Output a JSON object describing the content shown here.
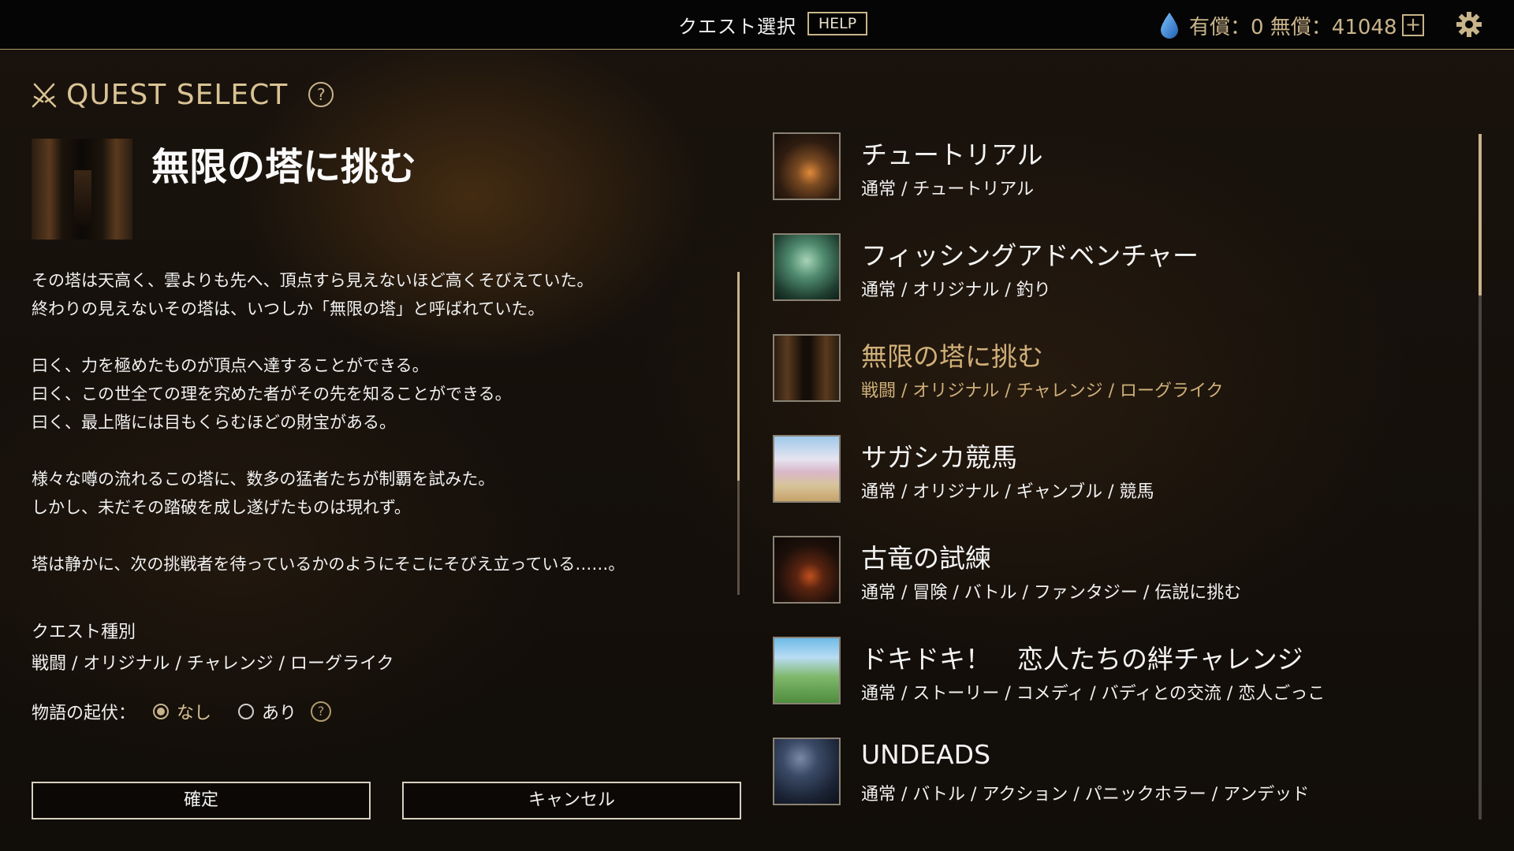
{
  "topbar": {
    "title": "クエスト選択",
    "help_label": "HELP",
    "currency_text": "有償：0 無償：41048",
    "plus_label": "+",
    "icons": [
      "drop-icon",
      "gear-icon"
    ]
  },
  "header": {
    "title": "QUEST SELECT",
    "help_label": "?"
  },
  "detail": {
    "title": "無限の塔に挑む",
    "description": [
      "その塔は天高く、雲よりも先へ、頂点すら見えないほど高くそびえていた。",
      "終わりの見えないその塔は、いつしか「無限の塔」と呼ばれていた。",
      "",
      "曰く、力を極めたものが頂点へ達することができる。",
      "曰く、この世全ての理を究めた者がその先を知ることができる。",
      "曰く、最上階には目もくらむほどの財宝がある。",
      "",
      "様々な噂の流れるこの塔に、数多の猛者たちが制覇を試みた。",
      "しかし、未だその踏破を成し遂げたものは現れず。",
      "",
      "塔は静かに、次の挑戦者を待っているかのようにそこにそびえ立っている……。"
    ],
    "type_label": "クエスト種別",
    "type_value": "戦闘 / オリジナル / チャレンジ / ローグライク",
    "rise_label": "物語の起伏：",
    "rise_options": [
      "なし",
      "あり"
    ],
    "rise_selected": "なし",
    "rise_help": "?"
  },
  "buttons": {
    "confirm": "確定",
    "cancel": "キャンセル"
  },
  "quests": [
    {
      "name": "チュートリアル",
      "tags": "通常 / チュートリアル",
      "selected": false
    },
    {
      "name": "フィッシングアドベンチャー",
      "tags": "通常 / オリジナル / 釣り",
      "selected": false
    },
    {
      "name": "無限の塔に挑む",
      "tags": "戦闘 / オリジナル / チャレンジ / ローグライク",
      "selected": true
    },
    {
      "name": "サガシカ競馬",
      "tags": "通常 / オリジナル / ギャンブル / 競馬",
      "selected": false
    },
    {
      "name": "古竜の試練",
      "tags": "通常 / 冒険 / バトル / ファンタジー / 伝説に挑む",
      "selected": false
    },
    {
      "name": "ドキドキ！　恋人たちの絆チャレンジ",
      "tags": "通常 / ストーリー / コメディ / バディとの交流 / 恋人ごっこ",
      "selected": false
    },
    {
      "name": "UNDEADS",
      "tags": "通常 / バトル / アクション / パニックホラー / アンデッド",
      "selected": false
    }
  ],
  "colors": {
    "accent_gold": "#d9c394",
    "selected_text": "#d0b07a",
    "topbar_bg": "#060505"
  }
}
